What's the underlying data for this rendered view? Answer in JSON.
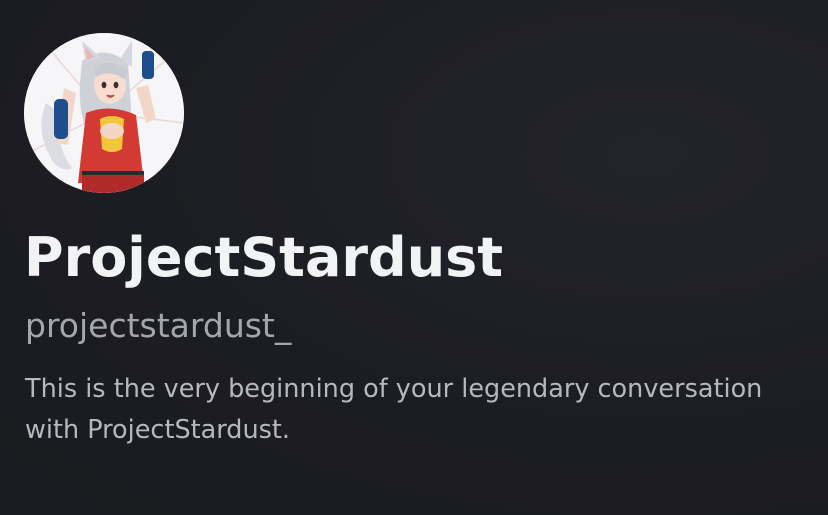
{
  "profile": {
    "avatar_alt": "anime character avatar",
    "display_name": "ProjectStardust",
    "username": "projectstardust_"
  },
  "conversation": {
    "intro_text": "This is the very beginning of your legendary conversation with ProjectStardust."
  },
  "colors": {
    "background": "#1c1d22",
    "display_name": "#f2f3f5",
    "username": "#a3a6ad",
    "intro": "#b5b8be"
  }
}
